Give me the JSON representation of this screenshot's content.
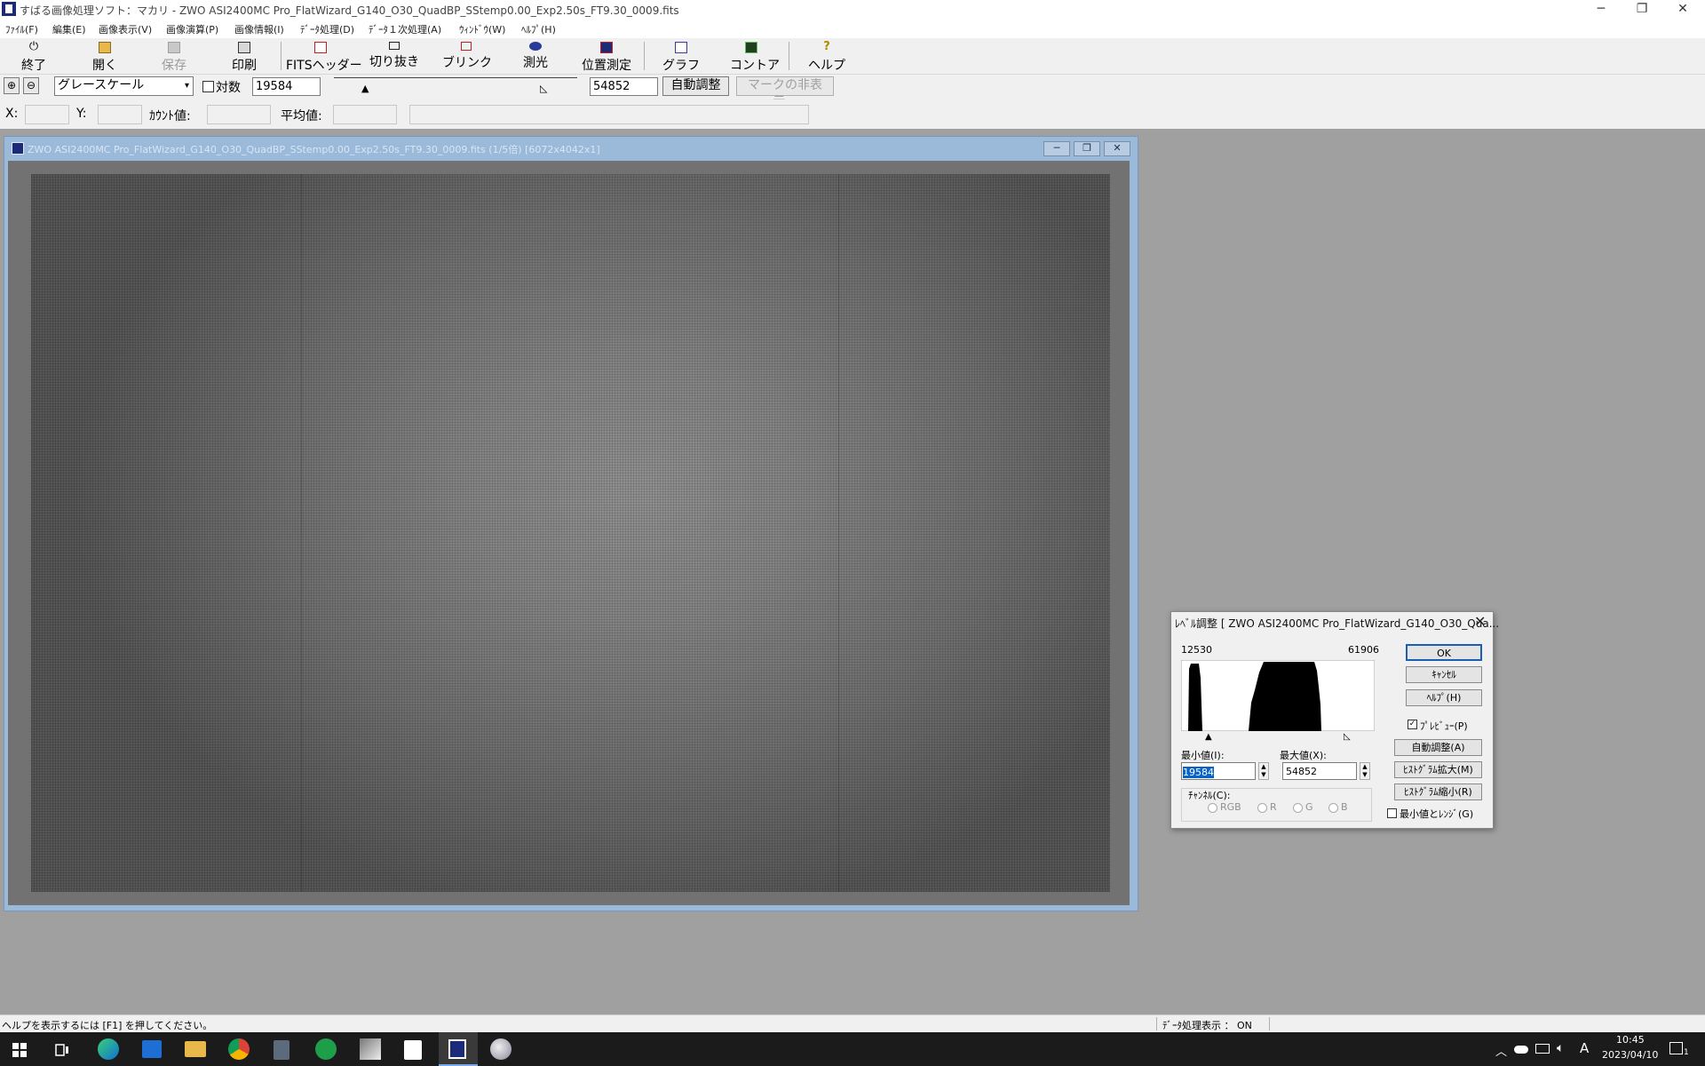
{
  "window": {
    "title": "すばる画像処理ソフト：マカリ - ZWO ASI2400MC Pro_FlatWizard_G140_O30_QuadBP_SStemp0.00_Exp2.50s_FT9.30_0009.fits",
    "minimize": "─",
    "restore": "❐",
    "close": "✕"
  },
  "menu": [
    "ﾌｧｲﾙ(F)",
    "編集(E)",
    "画像表示(V)",
    "画像演算(P)",
    "画像情報(I)",
    "ﾃﾞｰﾀ処理(D)",
    "ﾃﾞｰﾀ１次処理(A)",
    "ｳｨﾝﾄﾞｳ(W)",
    "ﾍﾙﾌﾟ(H)"
  ],
  "toolbar": {
    "exit": "終了",
    "open": "開く",
    "save": "保存",
    "print": "印刷",
    "fits_header": "FITSヘッダー",
    "crop": "切り抜き",
    "blink": "ブリンク",
    "photometry": "測光",
    "astrometry": "位置測定",
    "graph": "グラフ",
    "contour": "コントア",
    "help": "ヘルプ"
  },
  "controls": {
    "colormode": "グレースケール",
    "log_label": "対数",
    "min_value": "19584",
    "max_value": "54852",
    "auto_adjust": "自動調整",
    "hide_marks": "マークの非表示..."
  },
  "info": {
    "x_label": "X:",
    "y_label": "Y:",
    "count_label": "ｶｳﾝﾄ値:",
    "mean_label": "平均値:"
  },
  "image_window": {
    "title": "ZWO ASI2400MC Pro_FlatWizard_G140_O30_QuadBP_SStemp0.00_Exp2.50s_FT9.30_0009.fits (1/5倍) [6072x4042x1]"
  },
  "level_dialog": {
    "title": "ﾚﾍﾞﾙ調整 [ ZWO ASI2400MC Pro_FlatWizard_G140_O30_Qua...",
    "hist_min": "12530",
    "hist_max": "61906",
    "min_label": "最小値(I):",
    "max_label": "最大値(X):",
    "min_value": "19584",
    "max_value": "54852",
    "channel_label": "ﾁｬﾝﾈﾙ(C):",
    "channels": [
      "RGB",
      "R",
      "G",
      "B"
    ],
    "ok": "OK",
    "cancel": "ｷｬﾝｾﾙ",
    "help": "ﾍﾙﾌﾟ(H)",
    "preview": "ﾌﾟﾚﾋﾞｭｰ(P)",
    "auto": "自動調整(A)",
    "hist_expand": "ﾋｽﾄｸﾞﾗﾑ拡大(M)",
    "hist_shrink": "ﾋｽﾄｸﾞﾗﾑ縮小(R)",
    "min_range": "最小値とﾚﾝｼﾞ(G)"
  },
  "status": {
    "help_text": "ヘルプを表示するには [F1] を押してください。",
    "data_display": "ﾃﾞｰﾀ処理表示 ： ON"
  },
  "taskbar": {
    "time": "10:45",
    "date": "2023/04/10",
    "ime": "A",
    "notifications": "1"
  }
}
